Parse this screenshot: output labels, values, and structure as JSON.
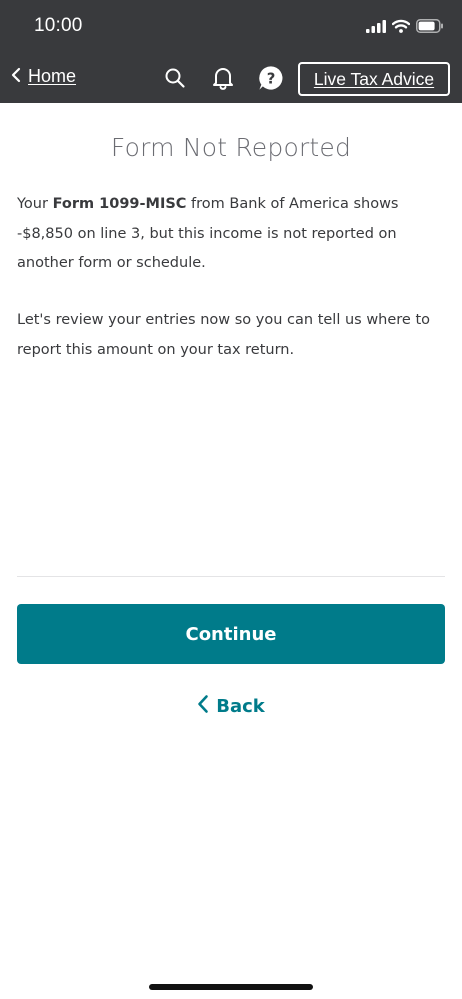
{
  "status_bar": {
    "time": "10:00",
    "icons": [
      "signal-icon",
      "wifi-icon",
      "battery-icon"
    ]
  },
  "nav": {
    "back_label": "Home",
    "icons": [
      "search-icon",
      "bell-icon",
      "help-icon"
    ],
    "help_glyph": "?",
    "live_advice_label": "Live Tax Advice"
  },
  "content": {
    "title": "Form Not Reported",
    "p1_prefix": "Your ",
    "p1_bold": "Form 1099-MISC",
    "p1_suffix": " from Bank of America shows -$8,850 on line 3, but this income is not reported on another form or schedule.",
    "p2": "Let's review your entries now so you can tell us where to report this amount on your tax return."
  },
  "actions": {
    "continue_label": "Continue",
    "back_label": "Back"
  },
  "colors": {
    "header_bg": "#393a3d",
    "accent": "#007b8a",
    "title": "#6b6c72",
    "text": "#393a3d"
  }
}
